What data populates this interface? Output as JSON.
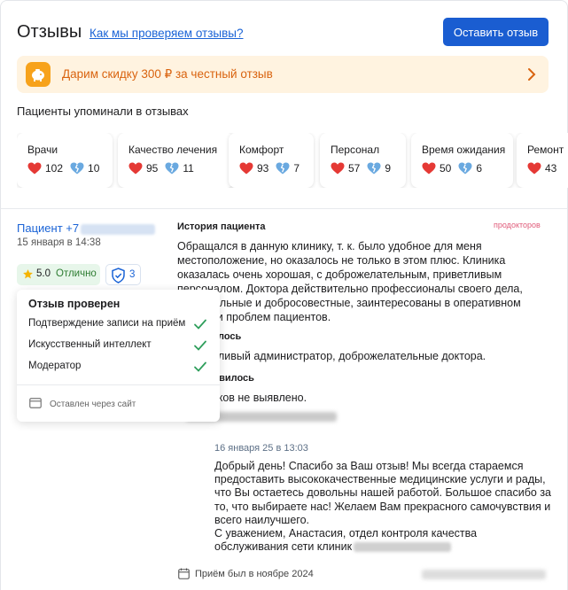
{
  "header": {
    "title": "Отзывы",
    "how_link": "Как мы проверяем отзывы?",
    "leave_button": "Оставить отзыв"
  },
  "promo": {
    "text": "Дарим скидку 300 ₽ за честный отзыв",
    "icon": "piggy-bank-icon",
    "arrow_icon": "chevron-right-icon"
  },
  "mentions": {
    "label": "Пациенты упоминали в отзывах",
    "items": [
      {
        "label": "Врачи",
        "likes": "102",
        "dislikes": "10"
      },
      {
        "label": "Качество лечения",
        "likes": "95",
        "dislikes": "11"
      },
      {
        "label": "Комфорт",
        "likes": "93",
        "dislikes": "7"
      },
      {
        "label": "Персонал",
        "likes": "57",
        "dislikes": "9"
      },
      {
        "label": "Время ожидания",
        "likes": "50",
        "dislikes": "6"
      },
      {
        "label": "Ремонт",
        "likes": "43",
        "dislikes": ""
      }
    ]
  },
  "review": {
    "author": "Пациент +7",
    "date": "15 января в 14:38",
    "rating_value": "5.0",
    "rating_word": "Отлично",
    "checks_count": "3",
    "verify": {
      "title": "Отзыв проверен",
      "items": [
        "Подтверждение записи на приём",
        "Искусственный интеллект",
        "Модератор"
      ],
      "footer": "Оставлен через сайт"
    },
    "history_label": "История пациента",
    "source": "продокторов",
    "text": "Обращался в данную клинику, т. к. было удобное для меня местоположение, но оказалось не только в этом плюс. Клиника оказалась очень хорошая, с доброжелательным, приветливым персоналом. Доктора действительно профессионалы своего дела, внимательные и добросовестные, заинтересованы в оперативном решении проблем пациентов.",
    "liked_label": "лось",
    "liked_text": "ливый администратор, доброжелательные доктора.",
    "disliked_label": "авилось",
    "disliked_text": "тков не выявлено.",
    "reply": {
      "date": "16 января 25 в 13:03",
      "text": "Добрый день! Спасибо за Ваш отзыв! Мы всегда стараемся предоставить высококачественные медицинские услуги и рады, что Вы остаетесь довольны нашей работой. Большое спасибо за то, что выбираете нас! Желаем Вам прекрасного самочувствия и всего наилучшего.",
      "signature": "С уважением, Анастасия, отдел контроля качества обслуживания сети клиник"
    },
    "visit": "Приём был в ноябре 2024"
  },
  "colors": {
    "accent": "#1a5dd1",
    "link": "#1a63d6",
    "promo_bg": "#fff3e0",
    "promo_text": "#d9630f",
    "heart": "#e53935",
    "broken_heart": "#6aa9e0",
    "check": "#2e9e5b"
  }
}
